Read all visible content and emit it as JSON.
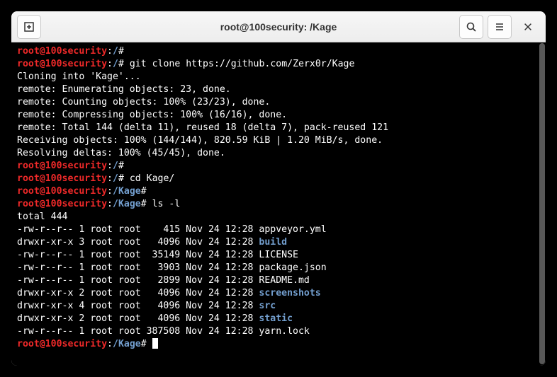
{
  "titlebar": {
    "title": "root@100security: /Kage"
  },
  "prompt": {
    "user_host": "root@100security",
    "sep": ":",
    "root_path": "/",
    "kage_path": "/Kage",
    "hash": "#"
  },
  "commands": {
    "empty": "",
    "git_clone": " git clone https://github.com/Zerx0r/Kage",
    "cd_kage": " cd Kage/",
    "ls_l": " ls -l"
  },
  "clone_output": [
    "Cloning into 'Kage'...",
    "remote: Enumerating objects: 23, done.",
    "remote: Counting objects: 100% (23/23), done.",
    "remote: Compressing objects: 100% (16/16), done.",
    "remote: Total 144 (delta 11), reused 18 (delta 7), pack-reused 121",
    "Receiving objects: 100% (144/144), 820.59 KiB | 1.20 MiB/s, done.",
    "Resolving deltas: 100% (45/45), done."
  ],
  "ls_total": "total 444",
  "ls_rows": [
    {
      "meta": "-rw-r--r-- 1 root root    415 Nov 24 12:28 ",
      "name": "appveyor.yml",
      "dir": false
    },
    {
      "meta": "drwxr-xr-x 3 root root   4096 Nov 24 12:28 ",
      "name": "build",
      "dir": true
    },
    {
      "meta": "-rw-r--r-- 1 root root  35149 Nov 24 12:28 ",
      "name": "LICENSE",
      "dir": false
    },
    {
      "meta": "-rw-r--r-- 1 root root   3903 Nov 24 12:28 ",
      "name": "package.json",
      "dir": false
    },
    {
      "meta": "-rw-r--r-- 1 root root   2899 Nov 24 12:28 ",
      "name": "README.md",
      "dir": false
    },
    {
      "meta": "drwxr-xr-x 2 root root   4096 Nov 24 12:28 ",
      "name": "screenshots",
      "dir": true
    },
    {
      "meta": "drwxr-xr-x 4 root root   4096 Nov 24 12:28 ",
      "name": "src",
      "dir": true
    },
    {
      "meta": "drwxr-xr-x 2 root root   4096 Nov 24 12:28 ",
      "name": "static",
      "dir": true
    },
    {
      "meta": "-rw-r--r-- 1 root root 387508 Nov 24 12:28 ",
      "name": "yarn.lock",
      "dir": false
    }
  ]
}
